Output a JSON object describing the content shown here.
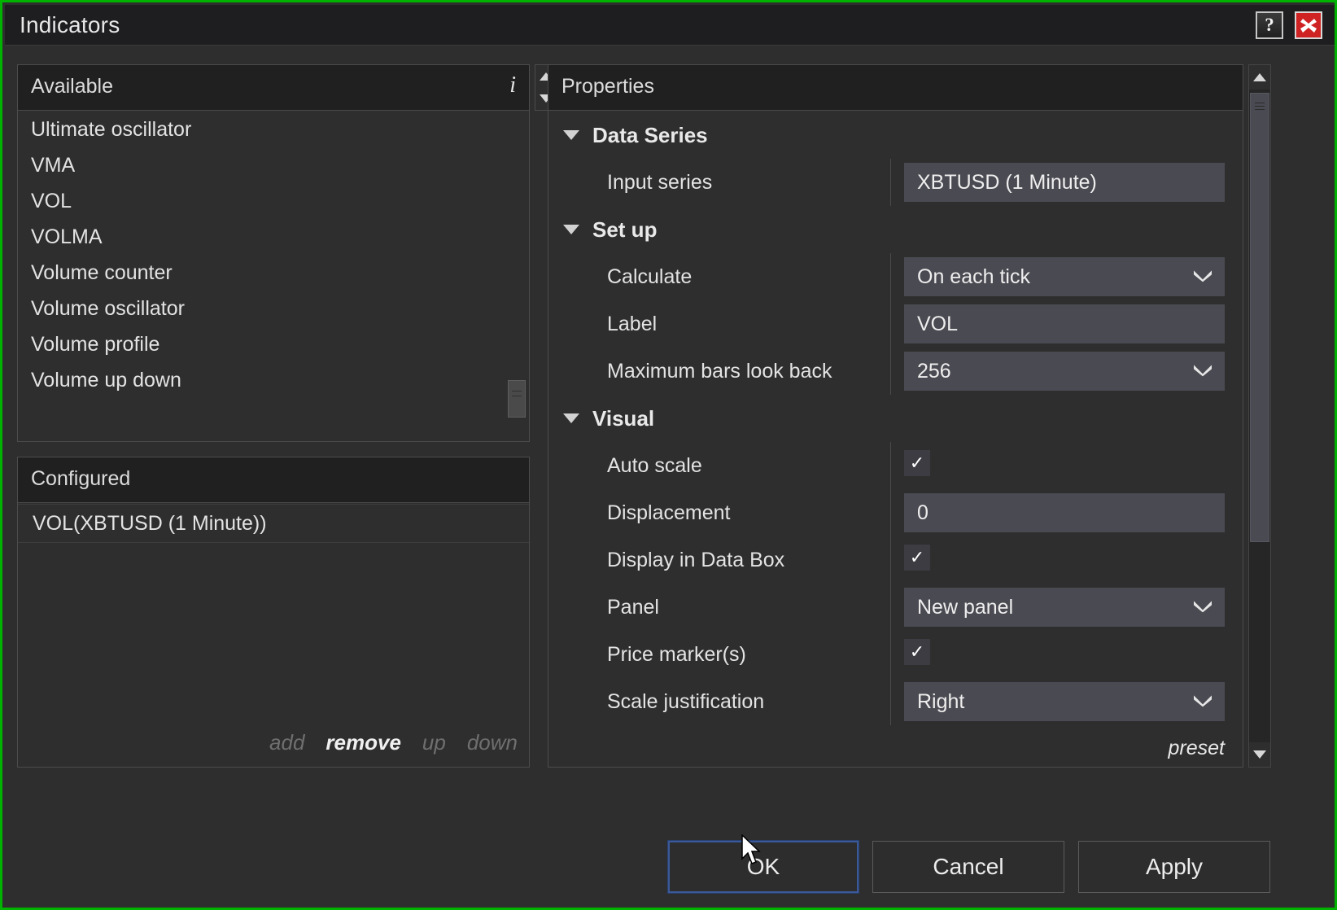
{
  "window": {
    "title": "Indicators",
    "help_button": "?",
    "close_button": "close-icon",
    "accent_border_color": "#00b300"
  },
  "available": {
    "header": "Available",
    "info_icon": "i",
    "items": [
      "Ultimate oscillator",
      "VMA",
      "VOL",
      "VOLMA",
      "Volume counter",
      "Volume oscillator",
      "Volume profile",
      "Volume up down"
    ]
  },
  "configured": {
    "header": "Configured",
    "items": [
      "VOL(XBTUSD (1 Minute))"
    ],
    "actions": [
      {
        "label": "add",
        "enabled": false
      },
      {
        "label": "remove",
        "enabled": true
      },
      {
        "label": "up",
        "enabled": false
      },
      {
        "label": "down",
        "enabled": false
      }
    ]
  },
  "properties": {
    "header": "Properties",
    "preset_label": "preset",
    "groups": [
      {
        "name": "Data Series",
        "rows": [
          {
            "label": "Input series",
            "type": "text",
            "value": "XBTUSD (1 Minute)"
          }
        ]
      },
      {
        "name": "Set up",
        "rows": [
          {
            "label": "Calculate",
            "type": "dropdown",
            "value": "On each tick"
          },
          {
            "label": "Label",
            "type": "text",
            "value": "VOL"
          },
          {
            "label": "Maximum bars look back",
            "type": "dropdown",
            "value": "256"
          }
        ]
      },
      {
        "name": "Visual",
        "rows": [
          {
            "label": "Auto scale",
            "type": "checkbox",
            "value": "✓"
          },
          {
            "label": "Displacement",
            "type": "text",
            "value": "0"
          },
          {
            "label": "Display in Data Box",
            "type": "checkbox",
            "value": "✓"
          },
          {
            "label": "Panel",
            "type": "dropdown",
            "value": "New panel"
          },
          {
            "label": "Price marker(s)",
            "type": "checkbox",
            "value": "✓"
          },
          {
            "label": "Scale justification",
            "type": "dropdown",
            "value": "Right"
          }
        ]
      }
    ]
  },
  "footer": {
    "ok": "OK",
    "cancel": "Cancel",
    "apply": "Apply"
  }
}
